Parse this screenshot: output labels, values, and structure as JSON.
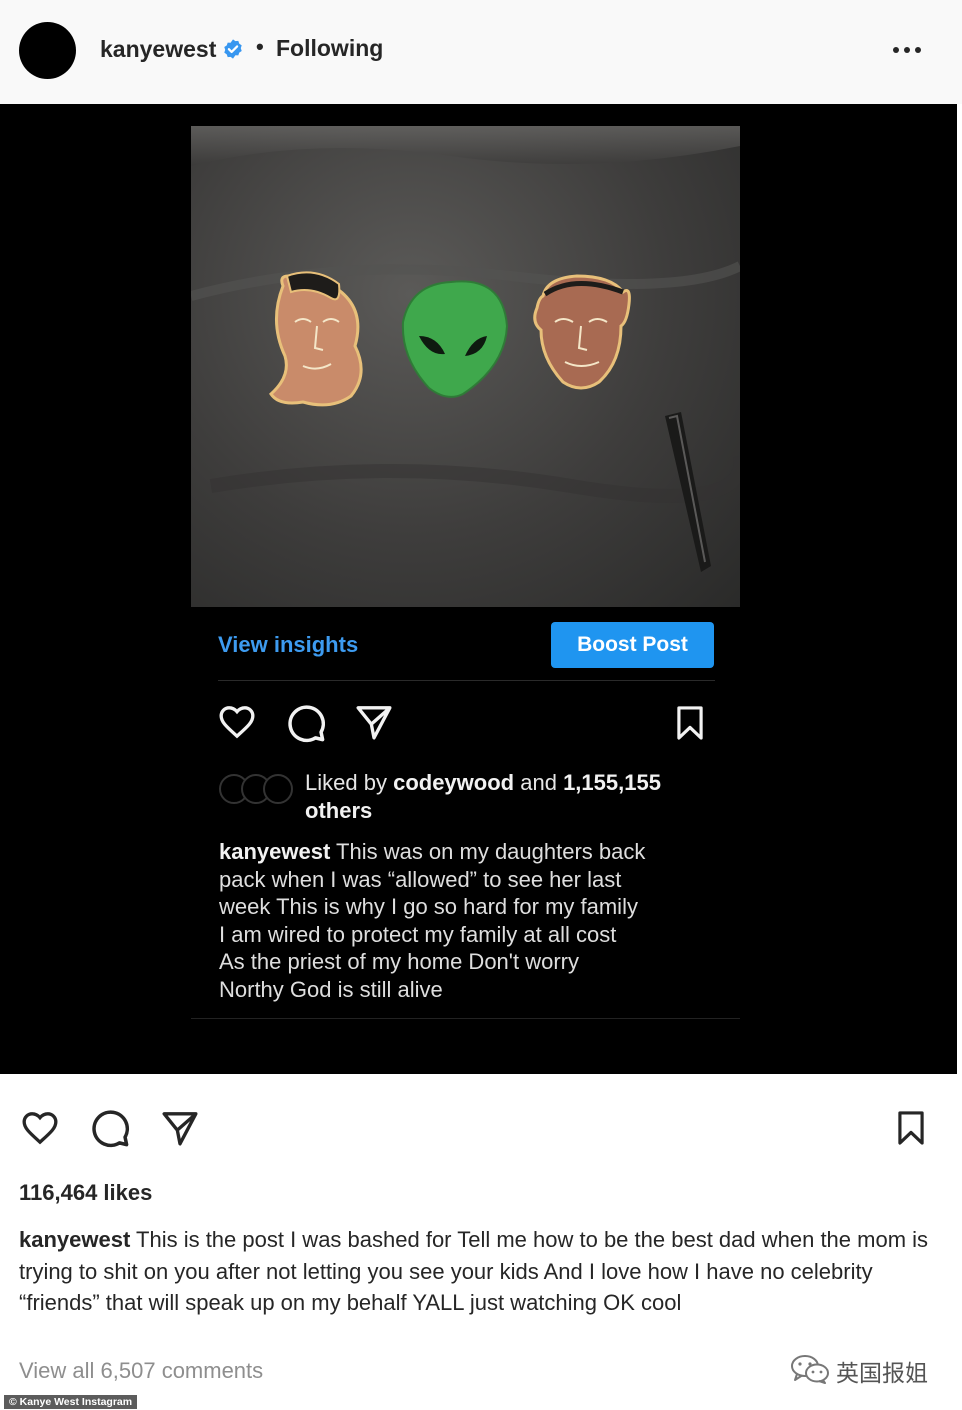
{
  "post": {
    "username": "kanyewest",
    "follow_status": "Following",
    "separator": "•"
  },
  "screenshot": {
    "insights_label": "View insights",
    "boost_label": "Boost Post",
    "liked_prefix": "Liked by",
    "liked_user": "codeywood",
    "liked_and": "and",
    "liked_count": "1,155,155",
    "liked_suffix": "others",
    "caption_user": "kanyewest",
    "caption_text": "This was on my daughters back\npack when I was “allowed” to see her last\nweek  This is why I go so hard for my family\nI am wired to protect my family at all cost\nAs the priest of my home  Don't worry\nNorthy  God is still alive"
  },
  "actions": {
    "likes": "116,464 likes",
    "caption_user": "kanyewest",
    "caption_text": "This is the post I was bashed for Tell me how to be the best dad when the mom is trying to shit on you after not letting you see your kids And I love how I have no celebrity “friends” that will speak up on my behalf YALL just watching OK cool",
    "view_comments": "View all 6,507 comments"
  },
  "watermark": {
    "text": "英国报姐",
    "icon": "wechat-icon"
  },
  "credit": "© Kanye West Instagram",
  "colors": {
    "link_blue": "#3d9bf0",
    "boost_blue": "#1f95f0",
    "verified_blue": "#3897f0",
    "pin_green": "#3fa84c"
  }
}
